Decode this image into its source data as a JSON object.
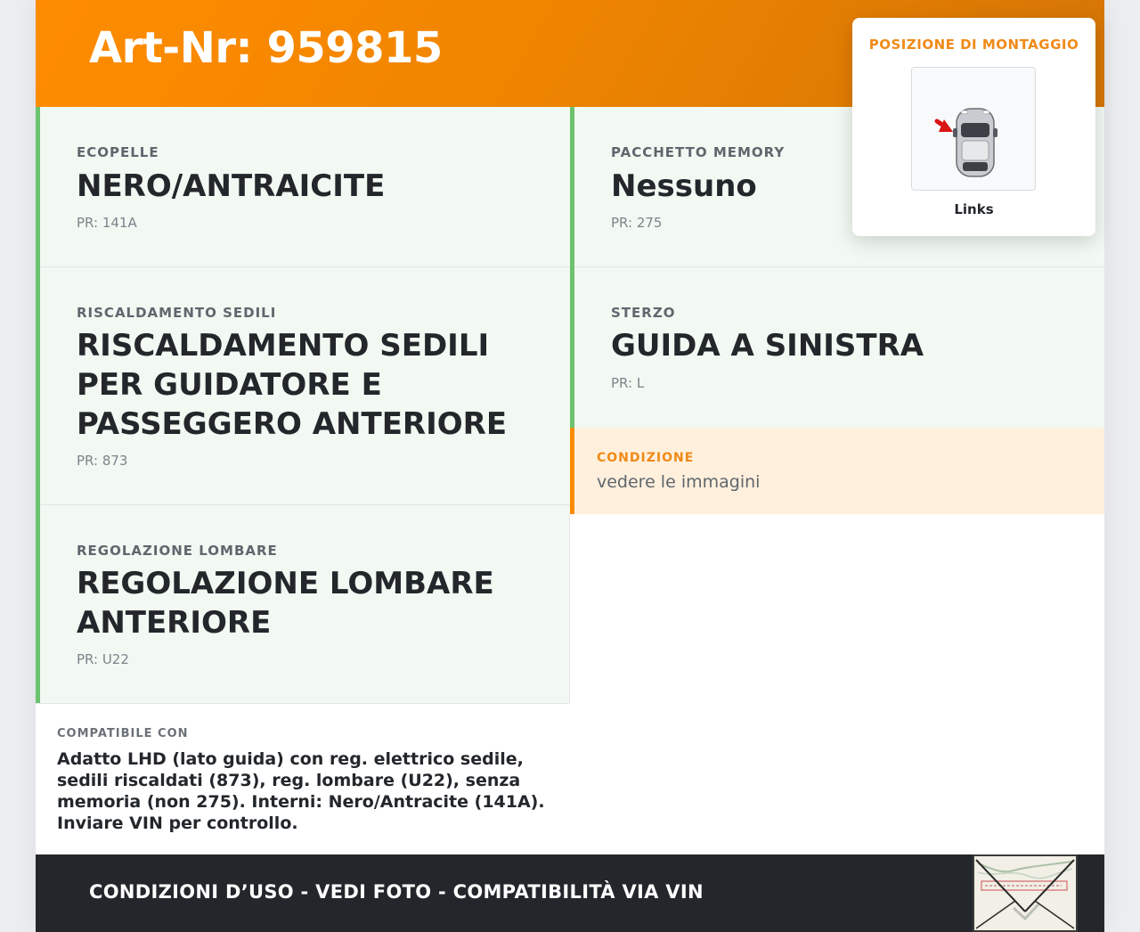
{
  "header": {
    "title": "Art-Nr: 959815"
  },
  "specs": {
    "ecopelle": {
      "label": "ECOPELLE",
      "value": "NERO/ANTRAICITE",
      "pr": "PR: 141A"
    },
    "memory": {
      "label": "PACCHETTO MEMORY",
      "value": "Nessuno",
      "pr": "PR: 275"
    },
    "heating": {
      "label": "RISCALDAMENTO SEDILI",
      "value": "RISCALDAMENTO SEDILI PER GUIDATORE E PASSEGGERO ANTERIORE",
      "pr": "PR: 873"
    },
    "steering": {
      "label": "STERZO",
      "value": "GUIDA A SINISTRA",
      "pr": "PR: L"
    },
    "lumbar": {
      "label": "REGOLAZIONE LOMBARE",
      "value": "REGOLAZIONE LOMBARE ANTERIORE",
      "pr": "PR: U22"
    }
  },
  "condition": {
    "label": "CONDIZIONE",
    "text": "vedere le immagini"
  },
  "compat": {
    "label": "COMPATIBILE CON",
    "text": "Adatto LHD (lato guida) con reg. elettrico sedile, sedili riscaldati (873), reg. lombare (U22), senza memoria (non 275). Interni: Nero/Antracite (141A). Inviare VIN per controllo."
  },
  "footer": {
    "text": "CONDIZIONI D’USO - VEDI FOTO - COMPATIBILITÀ VIA VIN"
  },
  "mounting": {
    "title": "POSIZIONE DI MONTAGGIO",
    "side": "Links",
    "icon": "car-top-view-icon",
    "arrow_icon": "red-arrow-icon"
  },
  "colors": {
    "accent_orange": "#ff8c00",
    "green_border": "#6cc26e",
    "cell_bg": "#f2f8f2",
    "condition_bg": "#fff0dd",
    "footer_bg": "#23262b"
  }
}
